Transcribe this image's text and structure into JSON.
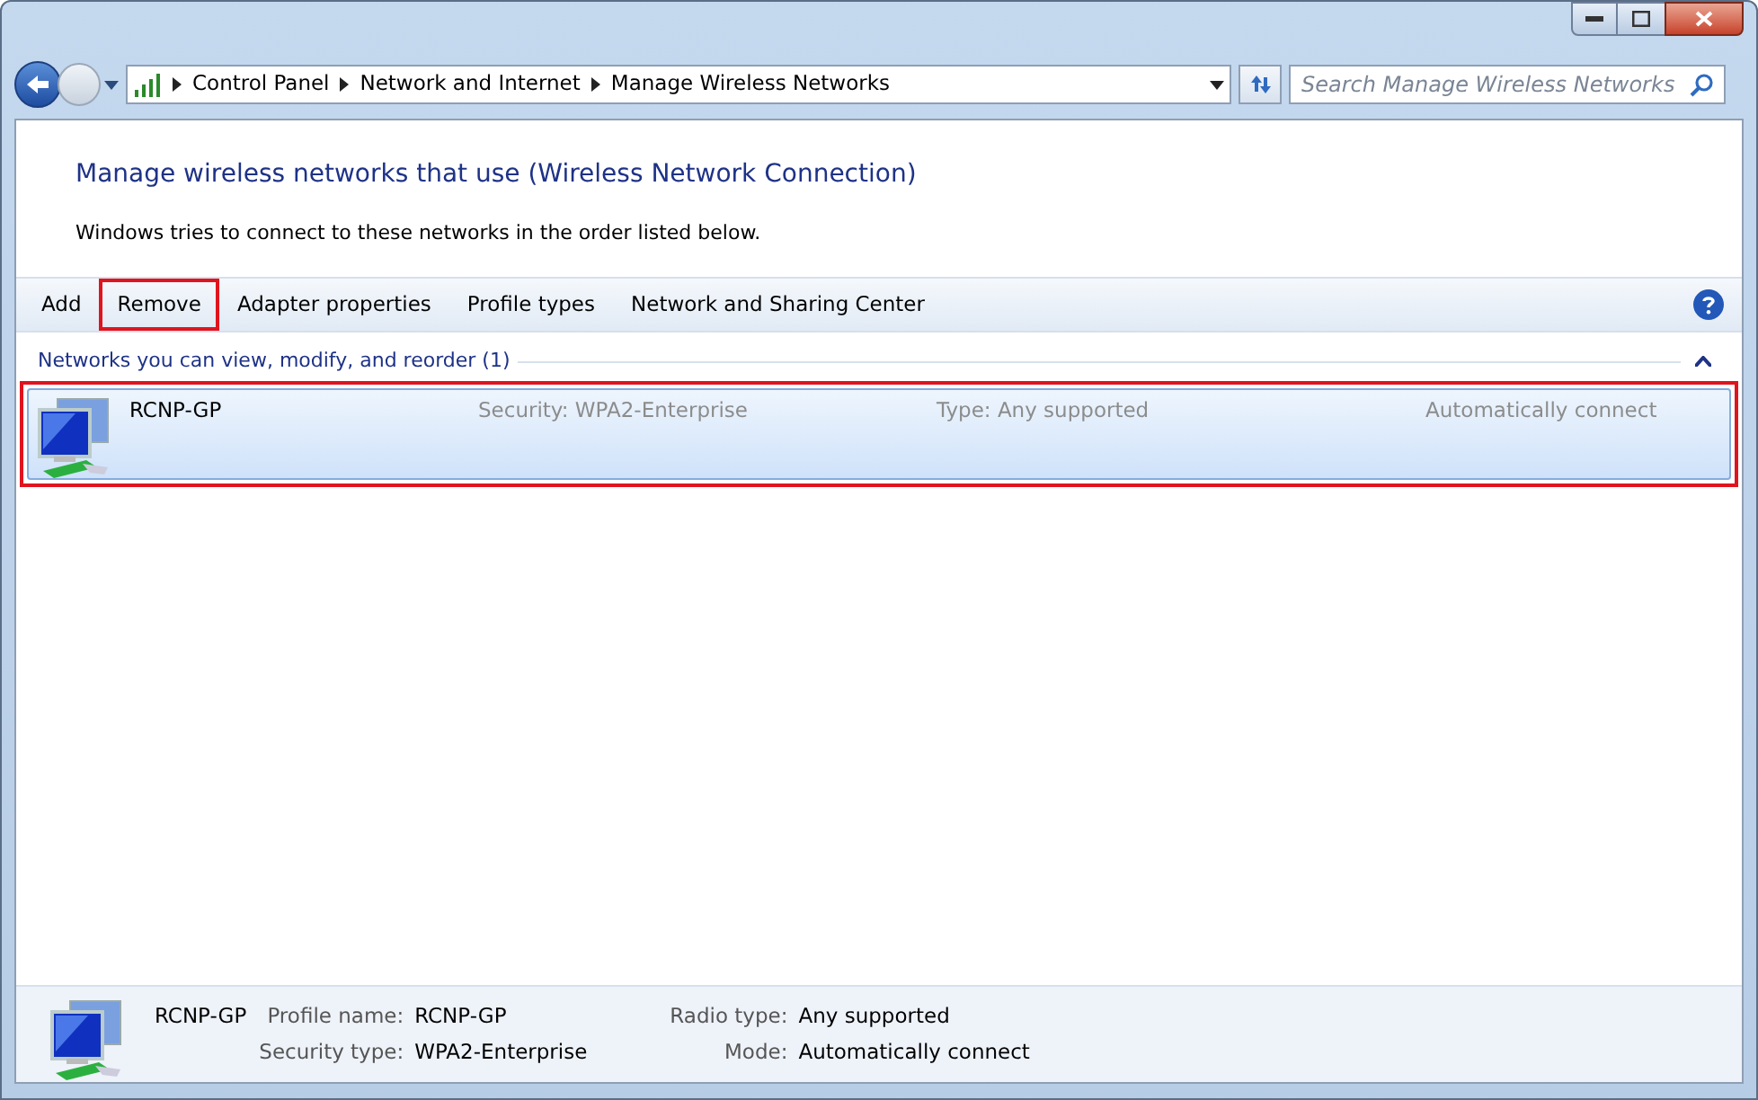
{
  "address_bar": {
    "crumbs": [
      "Control Panel",
      "Network and Internet",
      "Manage Wireless Networks"
    ]
  },
  "search": {
    "placeholder": "Search Manage Wireless Networks"
  },
  "heading": "Manage wireless networks that use (Wireless Network Connection)",
  "description": "Windows tries to connect to these networks in the order listed below.",
  "toolbar": [
    {
      "label": "Add",
      "highlighted": false
    },
    {
      "label": "Remove",
      "highlighted": true
    },
    {
      "label": "Adapter properties",
      "highlighted": false
    },
    {
      "label": "Profile types",
      "highlighted": false
    },
    {
      "label": "Network and Sharing Center",
      "highlighted": false
    }
  ],
  "group": {
    "title": "Networks you can view, modify, and reorder (1)",
    "expanded": true
  },
  "networks": [
    {
      "name": "RCNP-GP",
      "security_label": "Security:",
      "security": "WPA2-Enterprise",
      "type_label": "Type:",
      "type": "Any supported",
      "mode": "Automatically connect",
      "selected": true,
      "highlighted": true
    }
  ],
  "details": {
    "name": "RCNP-GP",
    "fields": [
      {
        "label": "Profile name:",
        "value": "RCNP-GP"
      },
      {
        "label": "Radio type:",
        "value": "Any supported"
      },
      {
        "label": "Security type:",
        "value": "WPA2-Enterprise"
      },
      {
        "label": "Mode:",
        "value": "Automatically connect"
      }
    ]
  }
}
